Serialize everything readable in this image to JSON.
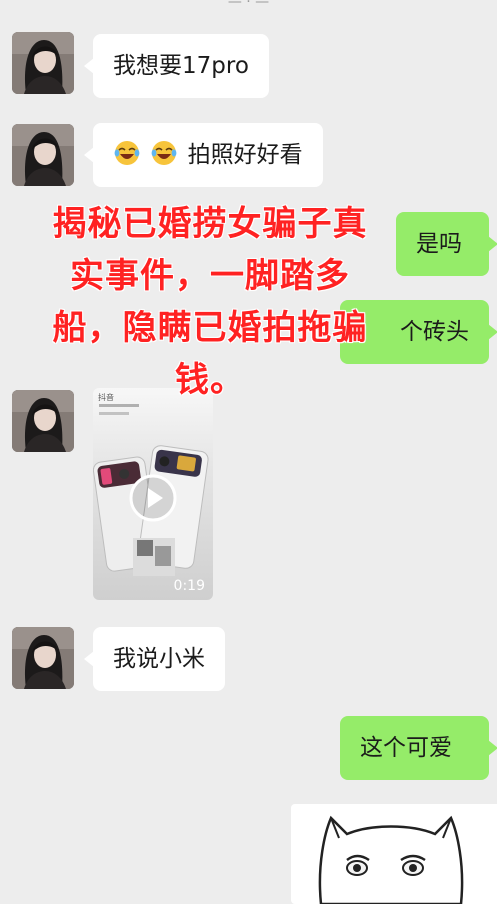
{
  "messages": {
    "m1": {
      "text": "我想要17pro"
    },
    "m2": {
      "emoji": [
        "crying-laughing-face-icon",
        "crying-laughing-face-icon"
      ],
      "text": "拍照好好看"
    },
    "m3": {
      "text": "是吗"
    },
    "m4": {
      "text": "个砖头"
    },
    "m5": {
      "video_app": "抖音",
      "duration": "0:19"
    },
    "m6": {
      "text": "我说小米"
    },
    "m7": {
      "text": "这个可爱"
    }
  },
  "overlay": {
    "title": "揭秘已婚捞女骗子真\n实事件，一脚踏多\n船，隐瞒已婚拍拖骗\n钱。",
    "color": "#ff2222"
  },
  "colors": {
    "chat_background": "#ededed",
    "left_bubble": "#ffffff",
    "right_bubble": "#95ec69"
  }
}
